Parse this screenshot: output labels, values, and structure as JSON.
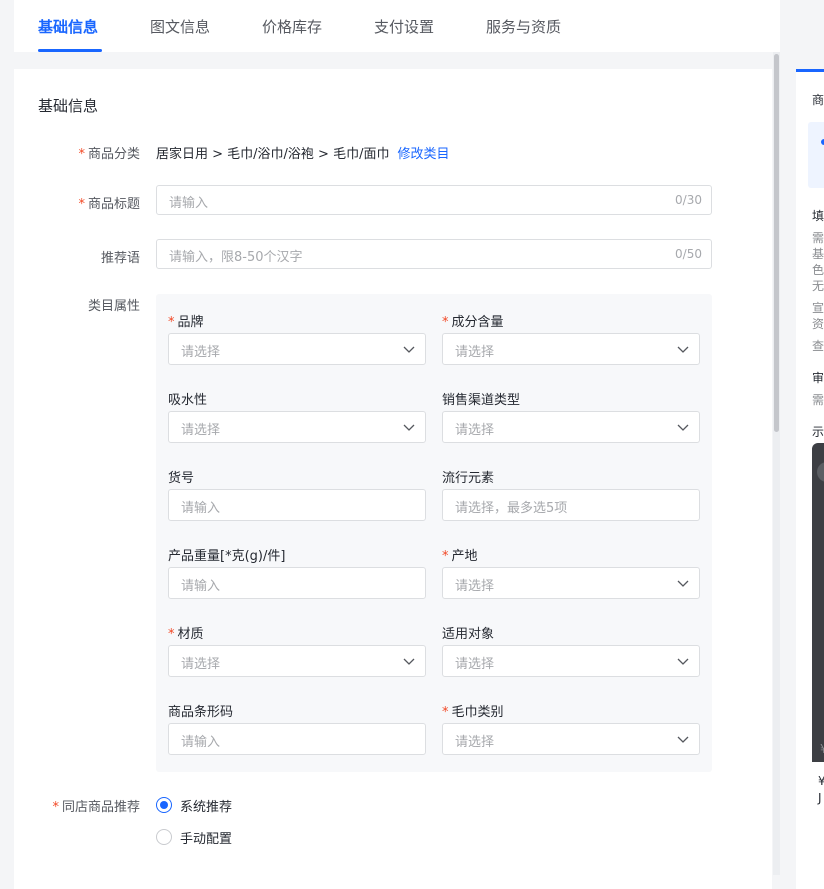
{
  "tabs": [
    {
      "label": "基础信息",
      "active": true
    },
    {
      "label": "图文信息",
      "active": false
    },
    {
      "label": "价格库存",
      "active": false
    },
    {
      "label": "支付设置",
      "active": false
    },
    {
      "label": "服务与资质",
      "active": false
    }
  ],
  "colors": {
    "accent": "#1966ff",
    "required": "#f24724"
  },
  "section_title": "基础信息",
  "category": {
    "label": "商品分类",
    "path": "居家日用 > 毛巾/浴巾/浴袍 > 毛巾/面巾",
    "edit_link": "修改类目"
  },
  "title_field": {
    "label": "商品标题",
    "placeholder": "请输入",
    "counter": "0/30"
  },
  "slogan_field": {
    "label": "推荐语",
    "placeholder": "请输入，限8-50个汉字",
    "counter": "0/50"
  },
  "attributes": {
    "label": "类目属性",
    "items": [
      {
        "label": "品牌",
        "required": true,
        "placeholder": "请选择",
        "kind": "select"
      },
      {
        "label": "成分含量",
        "required": true,
        "placeholder": "请选择",
        "kind": "select"
      },
      {
        "label": "吸水性",
        "required": false,
        "placeholder": "请选择",
        "kind": "select"
      },
      {
        "label": "销售渠道类型",
        "required": false,
        "placeholder": "请选择",
        "kind": "select"
      },
      {
        "label": "货号",
        "required": false,
        "placeholder": "请输入",
        "kind": "input"
      },
      {
        "label": "流行元素",
        "required": false,
        "placeholder": "请选择，最多选5项",
        "kind": "input"
      },
      {
        "label": "产品重量[*克(g)/件]",
        "required": false,
        "placeholder": "请输入",
        "kind": "input"
      },
      {
        "label": "产地",
        "required": true,
        "placeholder": "请选择",
        "kind": "select"
      },
      {
        "label": "材质",
        "required": true,
        "placeholder": "请选择",
        "kind": "select"
      },
      {
        "label": "适用对象",
        "required": false,
        "placeholder": "请选择",
        "kind": "select"
      },
      {
        "label": "商品条形码",
        "required": false,
        "placeholder": "请输入",
        "kind": "input"
      },
      {
        "label": "毛巾类别",
        "required": true,
        "placeholder": "请选择",
        "kind": "select"
      }
    ]
  },
  "recommend": {
    "label": "同店商品推荐",
    "options": [
      {
        "label": "系统推荐",
        "selected": true
      },
      {
        "label": "手动配置",
        "selected": false
      }
    ]
  },
  "side_panel": {
    "chars": [
      "商",
      "填",
      "需",
      "基",
      "色",
      "无",
      "宣",
      "资",
      "查",
      "审",
      "需",
      "示",
      "¥",
      "¥",
      "J"
    ]
  }
}
